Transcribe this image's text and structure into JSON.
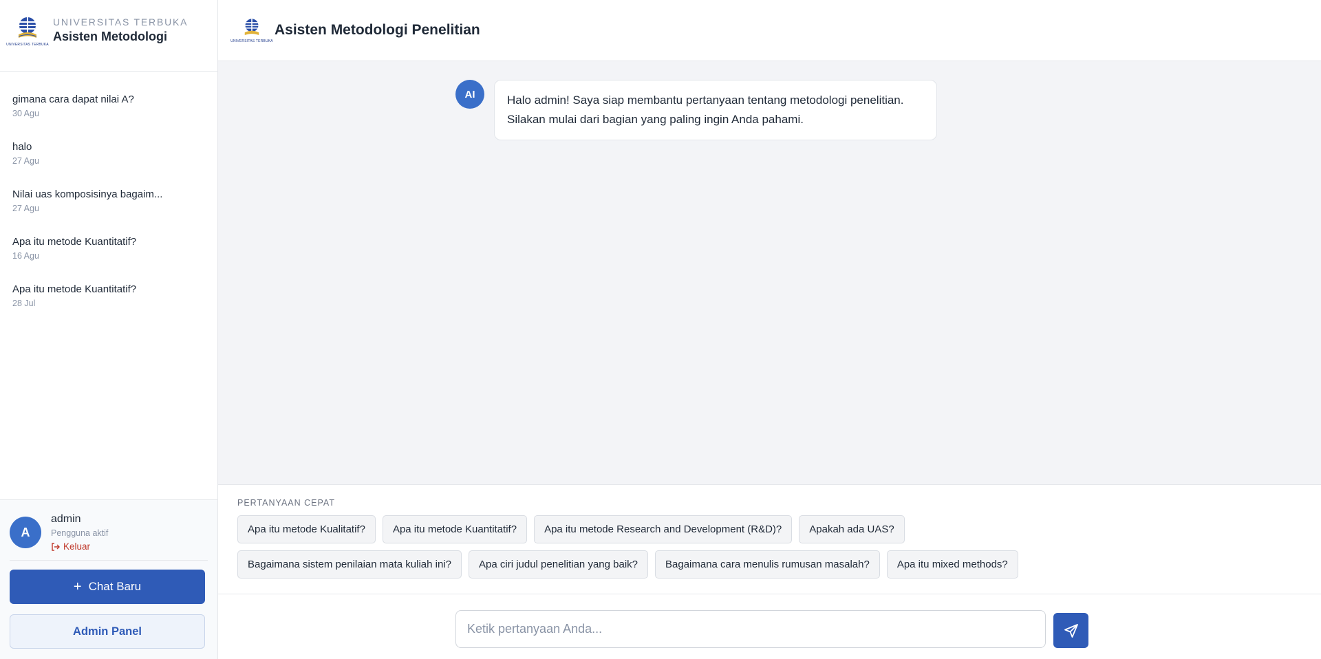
{
  "sidebar": {
    "org": "UNIVERSITAS TERBUKA",
    "title": "Asisten Metodologi",
    "logo_caption": "UNIVERSITAS TERBUKA",
    "history": [
      {
        "title": "gimana cara dapat nilai A?",
        "date": "30 Agu"
      },
      {
        "title": "halo",
        "date": "27 Agu"
      },
      {
        "title": "Nilai uas komposisinya bagaim...",
        "date": "27 Agu"
      },
      {
        "title": "Apa itu metode Kuantitatif?",
        "date": "16 Agu"
      },
      {
        "title": "Apa itu metode Kuantitatif?",
        "date": "28 Jul"
      }
    ],
    "user": {
      "initial": "A",
      "name": "admin",
      "status": "Pengguna aktif",
      "logout": "Keluar"
    },
    "new_chat_label": "Chat Baru",
    "admin_panel_label": "Admin Panel"
  },
  "header": {
    "title": "Asisten Metodologi Penelitian",
    "logo_caption": "UNIVERSITAS TERBUKA"
  },
  "chat": {
    "ai_avatar": "AI",
    "message": "Halo admin! Saya siap membantu pertanyaan tentang metodologi penelitian. Silakan mulai dari bagian yang paling ingin Anda pahami."
  },
  "quick": {
    "label": "PERTANYAAN CEPAT",
    "chips": [
      "Apa itu metode Kualitatif?",
      "Apa itu metode Kuantitatif?",
      "Apa itu metode Research and Development (R&D)?",
      "Apakah ada UAS?",
      "Bagaimana sistem penilaian mata kuliah ini?",
      "Apa ciri judul penelitian yang baik?",
      "Bagaimana cara menulis rumusan masalah?",
      "Apa itu mixed methods?"
    ]
  },
  "composer": {
    "placeholder": "Ketik pertanyaan Anda...",
    "send_icon": "send-icon"
  },
  "colors": {
    "primary": "#2f5bb7",
    "avatar": "#3a6fc9",
    "logout": "#c0392b"
  }
}
